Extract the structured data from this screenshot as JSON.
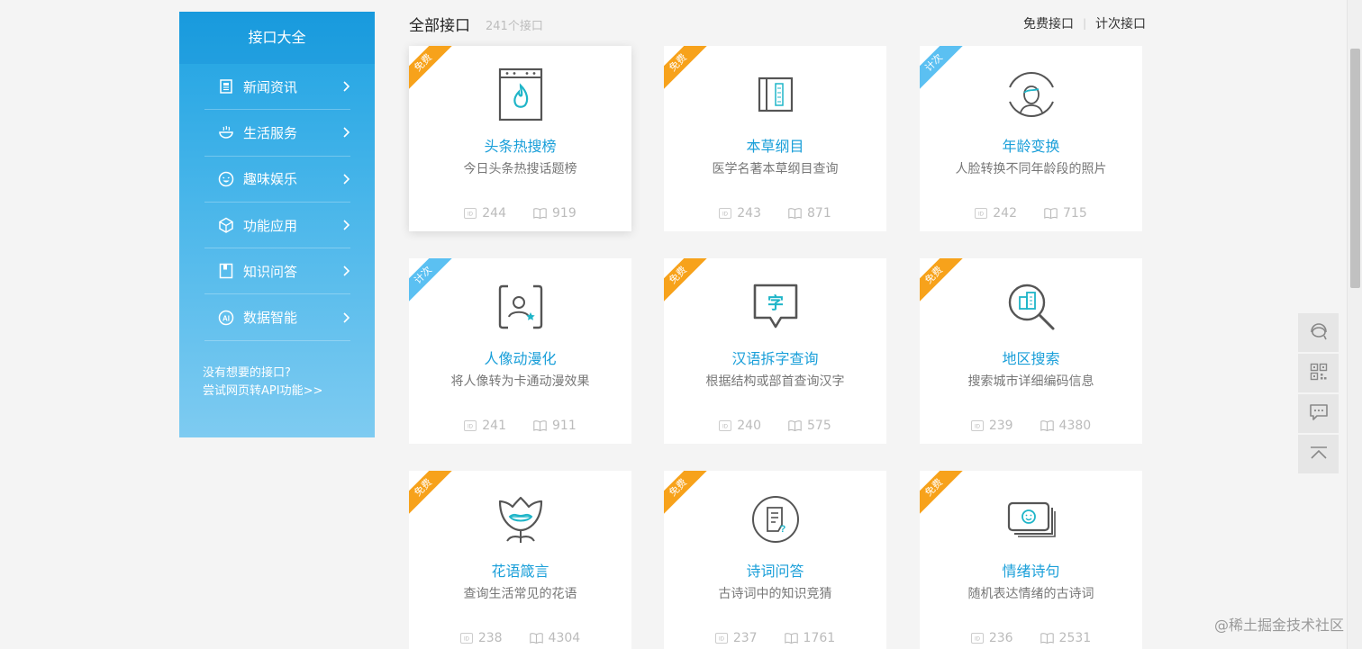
{
  "sidebar": {
    "title": "接口大全",
    "items": [
      {
        "label": "新闻资讯",
        "icon": "news-icon"
      },
      {
        "label": "生活服务",
        "icon": "bowl-icon"
      },
      {
        "label": "趣味娱乐",
        "icon": "smile-icon"
      },
      {
        "label": "功能应用",
        "icon": "cube-icon"
      },
      {
        "label": "知识问答",
        "icon": "book-icon"
      },
      {
        "label": "数据智能",
        "icon": "ai-icon"
      }
    ],
    "footer_line1": "没有想要的接口?",
    "footer_line2": "尝试网页转API功能>>"
  },
  "header": {
    "title": "全部接口",
    "count": "241个接口",
    "filter_free": "免费接口",
    "filter_sep": "|",
    "filter_paid": "计次接口"
  },
  "cards": [
    {
      "badge": "免费",
      "name": "头条热搜榜",
      "desc": "今日头条热搜话题榜",
      "id": "244",
      "views": "919",
      "icon": "flame-window-icon"
    },
    {
      "badge": "免费",
      "name": "本草纲目",
      "desc": "医学名著本草纲目查询",
      "id": "243",
      "views": "871",
      "icon": "ancient-book-icon"
    },
    {
      "badge": "计次",
      "name": "年龄变换",
      "desc": "人脸转换不同年龄段的照片",
      "id": "242",
      "views": "715",
      "icon": "face-portrait-icon"
    },
    {
      "badge": "计次",
      "name": "人像动漫化",
      "desc": "将人像转为卡通动漫效果",
      "id": "241",
      "views": "911",
      "icon": "portrait-frame-icon"
    },
    {
      "badge": "免费",
      "name": "汉语拆字查询",
      "desc": "根据结构或部首查询汉字",
      "id": "240",
      "views": "575",
      "icon": "character-bubble-icon"
    },
    {
      "badge": "免费",
      "name": "地区搜索",
      "desc": "搜索城市详细编码信息",
      "id": "239",
      "views": "4380",
      "icon": "city-search-icon"
    },
    {
      "badge": "免费",
      "name": "花语箴言",
      "desc": "查询生活常见的花语",
      "id": "238",
      "views": "4304",
      "icon": "flower-lips-icon"
    },
    {
      "badge": "免费",
      "name": "诗词问答",
      "desc": "古诗词中的知识竞猜",
      "id": "237",
      "views": "1761",
      "icon": "poem-question-icon"
    },
    {
      "badge": "免费",
      "name": "情绪诗句",
      "desc": "随机表达情绪的古诗词",
      "id": "236",
      "views": "2531",
      "icon": "emotion-card-icon"
    }
  ],
  "side_tools": [
    "headset-icon",
    "qrcode-icon",
    "chat-icon",
    "back-to-top-icon"
  ],
  "watermark": "@稀土掘金技术社区",
  "colors": {
    "accent": "#1a9fd9",
    "free_badge": "#f7a21b",
    "paid_badge": "#5bc0f2",
    "sidebar_top": "#1ea2e2",
    "sidebar_bottom": "#7ecbf1"
  }
}
